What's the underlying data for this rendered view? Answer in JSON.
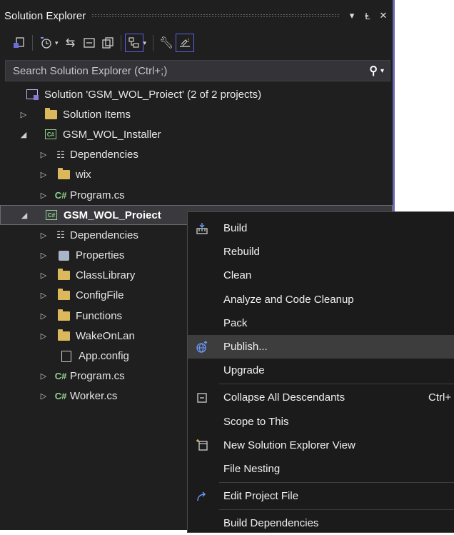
{
  "panel": {
    "title": "Solution Explorer",
    "pin_glyph": "−̄",
    "close_glyph": "✕",
    "dropdown_glyph": "▾"
  },
  "search": {
    "placeholder": "Search Solution Explorer (Ctrl+;)"
  },
  "tree": {
    "solution": "Solution 'GSM_WOL_Proiect' (2 of 2 projects)",
    "solution_items": "Solution Items",
    "installer": "GSM_WOL_Installer",
    "installer_deps": "Dependencies",
    "installer_wix": "wix",
    "installer_program": "Program.cs",
    "project": "GSM_WOL_Proiect",
    "project_deps": "Dependencies",
    "project_props": "Properties",
    "project_classlib": "ClassLibrary",
    "project_configfile": "ConfigFile",
    "project_functions": "Functions",
    "project_wakeonlan": "WakeOnLan",
    "project_appconfig": "App.config",
    "project_program": "Program.cs",
    "project_worker": "Worker.cs"
  },
  "icons": {
    "cs_glyph": "C#",
    "csproj_glyph": "C#",
    "dep_glyph": "☷",
    "arrow_right": "▷",
    "arrow_down": "◢"
  },
  "menu": {
    "build": "Build",
    "rebuild": "Rebuild",
    "clean": "Clean",
    "analyze": "Analyze and Code Cleanup",
    "pack": "Pack",
    "publish": "Publish...",
    "upgrade": "Upgrade",
    "collapse": "Collapse All Descendants",
    "collapse_shortcut": "Ctrl+",
    "scope": "Scope to This",
    "new_view": "New Solution Explorer View",
    "file_nesting": "File Nesting",
    "edit_project": "Edit Project File",
    "build_deps": "Build Dependencies"
  },
  "colors": {
    "panel_bg": "#1f1f1f",
    "accent": "#6b6bb5",
    "folder": "#dcb85c",
    "csharp": "#8fd18f"
  }
}
